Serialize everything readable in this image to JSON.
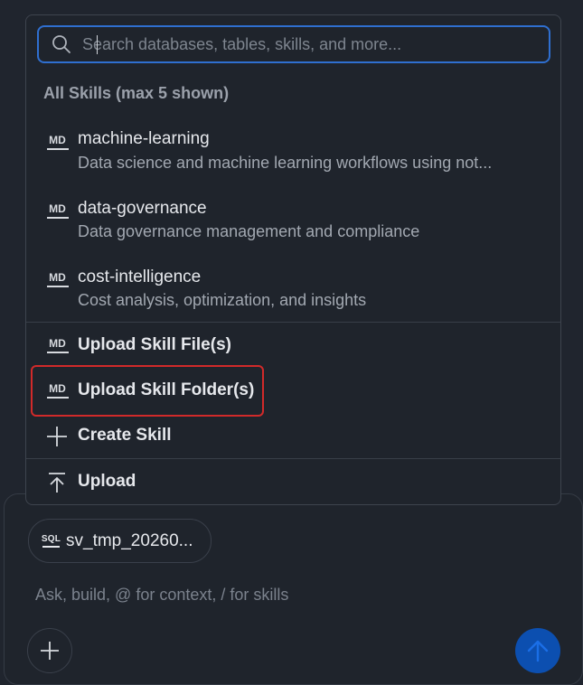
{
  "search": {
    "placeholder": "Search databases, tables, skills, and more...",
    "icon": "search-icon"
  },
  "section": {
    "title": "All Skills (max 5 shown)"
  },
  "skills": [
    {
      "icon_text": "MD",
      "name": "machine-learning",
      "description": "Data science and machine learning workflows using not..."
    },
    {
      "icon_text": "MD",
      "name": "data-governance",
      "description": "Data governance management and compliance"
    },
    {
      "icon_text": "MD",
      "name": "cost-intelligence",
      "description": "Cost analysis, optimization, and insights"
    }
  ],
  "actions": {
    "upload_file": {
      "icon_text": "MD",
      "label": "Upload Skill File(s)"
    },
    "upload_folder": {
      "icon_text": "MD",
      "label": "Upload Skill Folder(s)"
    },
    "create_skill": {
      "icon": "plus-icon",
      "label": "Create Skill"
    },
    "upload": {
      "icon": "upload-icon",
      "label": "Upload"
    }
  },
  "composer": {
    "attachment": {
      "icon_text": "SQL",
      "label": "sv_tmp_20260..."
    },
    "placeholder": "Ask, build, @ for context, / for skills",
    "add_button_icon": "plus-icon",
    "send_button_icon": "arrow-up-icon"
  },
  "colors": {
    "background": "#20252e",
    "accent": "#2f6fd0",
    "send_button": "#0c4fb0",
    "highlight": "#d12a2a"
  }
}
